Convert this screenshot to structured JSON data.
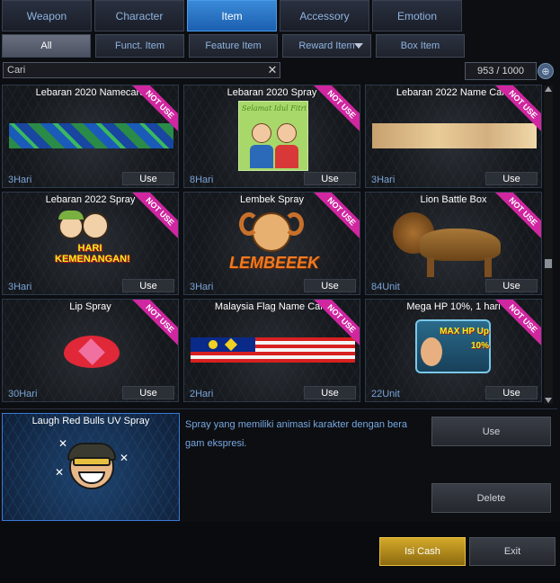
{
  "main_tabs": [
    {
      "label": "Weapon"
    },
    {
      "label": "Character"
    },
    {
      "label": "Item"
    },
    {
      "label": "Accessory"
    },
    {
      "label": "Emotion"
    }
  ],
  "active_main_tab": "Item",
  "sub_tabs": [
    {
      "label": "All"
    },
    {
      "label": "Funct. Item"
    },
    {
      "label": "Feature Item"
    },
    {
      "label": "Reward Item"
    },
    {
      "label": "Box Item"
    }
  ],
  "active_sub_tab": "All",
  "search": {
    "value": "Cari"
  },
  "inventory_count": "953 / 1000",
  "ribbon_text": "NOT USE",
  "use_label": "Use",
  "items": [
    {
      "name": "Lebaran 2020 Namecard",
      "duration": "3Hari",
      "icon": "ketupat-namecard-icon",
      "art_text": ""
    },
    {
      "name": "Lebaran 2020 Spray",
      "duration": "8Hari",
      "icon": "eid-spray-icon",
      "art_text": "Selamat Idul Fitri"
    },
    {
      "name": "Lebaran 2022 Name Card",
      "duration": "3Hari",
      "icon": "desert-namecard-icon",
      "art_text": ""
    },
    {
      "name": "Lebaran 2022 Spray",
      "duration": "3Hari",
      "icon": "hari-kemenangan-spray-icon",
      "art_text": "HARI KEMENANGAN!"
    },
    {
      "name": "Lembek Spray",
      "duration": "3Hari",
      "icon": "ram-spray-icon",
      "art_text": "LEMBEEEK"
    },
    {
      "name": "Lion Battle Box",
      "duration": "84Unit",
      "icon": "lion-icon",
      "art_text": ""
    },
    {
      "name": "Lip Spray",
      "duration": "30Hari",
      "icon": "lips-icon",
      "art_text": ""
    },
    {
      "name": "Malaysia Flag Name Card",
      "duration": "2Hari",
      "icon": "malaysia-flag-icon",
      "art_text": ""
    },
    {
      "name": "Mega HP 10%, 1 hari",
      "duration": "22Unit",
      "icon": "max-hp-up-icon",
      "art_text": "MAX HP Up 10%"
    }
  ],
  "detail": {
    "title": "Laugh Red Bulls UV Spray",
    "description": "Spray yang memiliki animasi karakter dengan bera gam ekspresi.",
    "use_label": "Use",
    "delete_label": "Delete"
  },
  "footer": {
    "cash_label": "Isi Cash",
    "exit_label": "Exit"
  },
  "colors": {
    "accent_blue": "#2a7ad8",
    "ribbon_pink": "#d026a0",
    "cash_gold": "#c89a20"
  }
}
